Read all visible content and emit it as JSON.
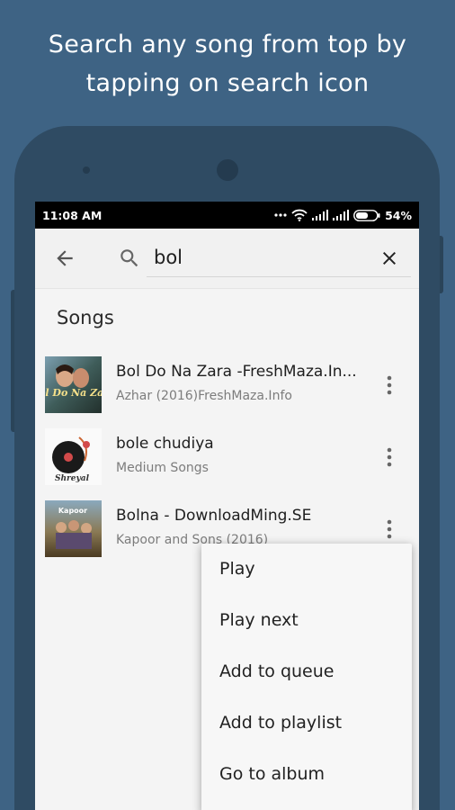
{
  "promo": {
    "headline_line1": "Search any song from top by",
    "headline_line2": "tapping on search icon"
  },
  "status_bar": {
    "time": "11:08 AM",
    "battery": "54%",
    "icons": [
      "dots-icon",
      "wifi-icon",
      "signal-icon",
      "signal-icon",
      "battery-icon"
    ]
  },
  "search": {
    "query": "bol",
    "icons": [
      "back-arrow-icon",
      "search-icon",
      "close-icon"
    ]
  },
  "results": {
    "section_title": "Songs",
    "songs": [
      {
        "title": "Bol Do Na Zara -FreshMaza.In...",
        "subtitle": "Azhar (2016)FreshMaza.Info",
        "art_text": "Bol Do Na Zara"
      },
      {
        "title": "bole chudiya",
        "subtitle": "Medium Songs",
        "art_text": "Shreyal"
      },
      {
        "title": "Bolna -  DownloadMing.SE",
        "subtitle": "Kapoor and Sons (2016)",
        "art_text": "Kapoor"
      }
    ]
  },
  "context_menu": {
    "items": [
      "Play",
      "Play next",
      "Add to queue",
      "Add to playlist",
      "Go to album"
    ]
  },
  "colors": {
    "background": "#3e6384",
    "phone_body": "#2f4b63",
    "screen": "#f4f4f4",
    "status_bar": "#000000"
  }
}
